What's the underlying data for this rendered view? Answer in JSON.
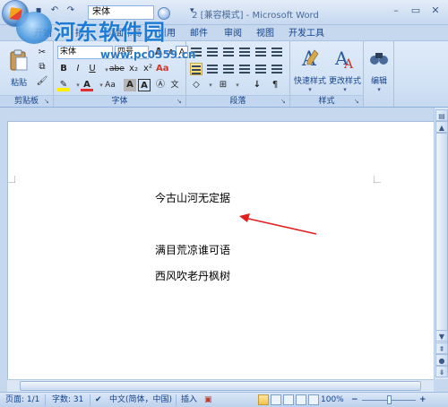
{
  "window": {
    "title": "2 [兼容模式] - Microsoft Word",
    "title_font_value": "宋体",
    "controls": [
      "minimize",
      "maximize",
      "close"
    ]
  },
  "watermark": {
    "title": "河东软件园",
    "url": "www.pc0359.cn"
  },
  "tabs": [
    {
      "label": "开始",
      "active": true
    },
    {
      "label": "插入"
    },
    {
      "label": "页面布局"
    },
    {
      "label": "引用"
    },
    {
      "label": "邮件"
    },
    {
      "label": "审阅"
    },
    {
      "label": "视图"
    },
    {
      "label": "开发工具"
    }
  ],
  "ribbon": {
    "clipboard": {
      "label": "剪贴板",
      "paste_label": "粘贴"
    },
    "font": {
      "label": "字体",
      "font_name": "宋体",
      "font_size": "四号",
      "grow": "A",
      "shrink": "A",
      "bold": "B",
      "italic": "I",
      "underline": "U",
      "strike": "abe",
      "subscript": "x₂",
      "superscript": "x²",
      "change_case": "Aa",
      "char_shade": "A",
      "char_border": "A",
      "wen": "文"
    },
    "paragraph": {
      "label": "段落"
    },
    "styles": {
      "label": "样式",
      "quick_styles": "快速样式",
      "change_styles": "更改样式"
    },
    "editing": {
      "label": "编辑"
    }
  },
  "document": {
    "lines": [
      "今古山河无定据",
      "满目荒凉谁可语",
      "西风吹老丹枫树"
    ]
  },
  "statusbar": {
    "page": "页面: 1/1",
    "words": "字数: 31",
    "language": "中文(简体，中国)",
    "mode": "插入",
    "zoom": "100%",
    "zoom_out": "−",
    "zoom_in": "+"
  },
  "colors": {
    "ribbon_text": "#15428b",
    "arrow": "#e02020",
    "watermark": "#1d7bd6"
  }
}
